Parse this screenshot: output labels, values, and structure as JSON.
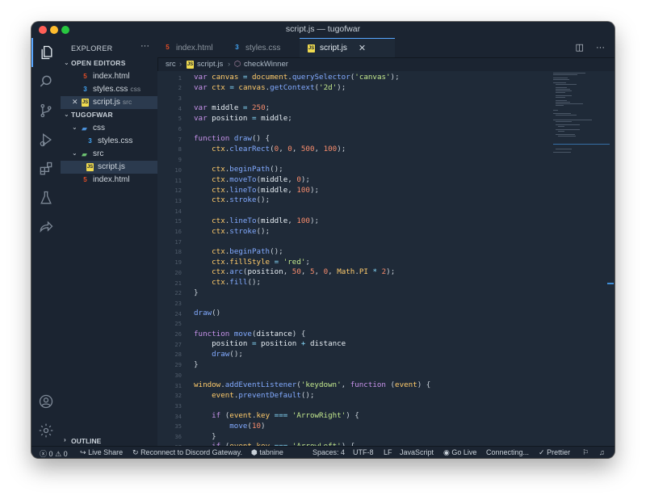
{
  "window": {
    "title": "script.js — tugofwar"
  },
  "sidebar": {
    "header": "EXPLORER",
    "more": "···",
    "open_editors_label": "OPEN EDITORS",
    "open_editors": [
      {
        "name": "index.html",
        "desc": ""
      },
      {
        "name": "styles.css",
        "desc": "css"
      },
      {
        "name": "script.js",
        "desc": "src"
      }
    ],
    "project_label": "TUGOFWAR",
    "tree": {
      "css_folder": "css",
      "styles": "styles.css",
      "src_folder": "src",
      "script": "script.js",
      "index": "index.html"
    },
    "outline_label": "OUTLINE"
  },
  "tabs": [
    {
      "label": "index.html"
    },
    {
      "label": "styles.css"
    },
    {
      "label": "script.js"
    }
  ],
  "tab_close": "✕",
  "breadcrumb": {
    "root": "src",
    "file": "script.js",
    "symbol": "checkWinner"
  },
  "line_numbers": [
    "1",
    "2",
    "3",
    "4",
    "5",
    "6",
    "7",
    "8",
    "9",
    "10",
    "11",
    "12",
    "13",
    "14",
    "15",
    "16",
    "17",
    "18",
    "19",
    "20",
    "21",
    "22",
    "23",
    "24",
    "25",
    "26",
    "27",
    "28",
    "29",
    "30",
    "31",
    "32",
    "33",
    "34",
    "35",
    "36",
    "37"
  ],
  "code": [
    "var canvas = document.querySelector('canvas');",
    "var ctx = canvas.getContext('2d');",
    "",
    "var middle = 250;",
    "var position = middle;",
    "",
    "function draw() {",
    "    ctx.clearRect(0, 0, 500, 100);",
    "",
    "    ctx.beginPath();",
    "    ctx.moveTo(middle, 0);",
    "    ctx.lineTo(middle, 100);",
    "    ctx.stroke();",
    "",
    "    ctx.lineTo(middle, 100);",
    "    ctx.stroke();",
    "",
    "    ctx.beginPath();",
    "    ctx.fillStyle = 'red';",
    "    ctx.arc(position, 50, 5, 0, Math.PI * 2);",
    "    ctx.fill();",
    "}",
    "",
    "draw()",
    "",
    "function move(distance) {",
    "    position = position + distance",
    "    draw();",
    "}",
    "",
    "window.addEventListener('keydown', function (event) {",
    "    event.preventDefault();",
    "",
    "    if (event.key === 'ArrowRight') {",
    "        move(10)",
    "    }",
    "    if (event.key === 'ArrowLeft') {"
  ],
  "status": {
    "errors": "0",
    "warnings": "0",
    "live_share": "Live Share",
    "discord": "Reconnect to Discord Gateway.",
    "tabnine": "tabnine",
    "spaces": "Spaces: 4",
    "encoding": "UTF-8",
    "eol": "LF",
    "language": "JavaScript",
    "go_live": "Go Live",
    "connecting": "Connecting...",
    "prettier": "Prettier"
  },
  "colors": {
    "accent": "#58a6ff",
    "background": "#1f2a38",
    "sidebar": "#1b2431"
  }
}
